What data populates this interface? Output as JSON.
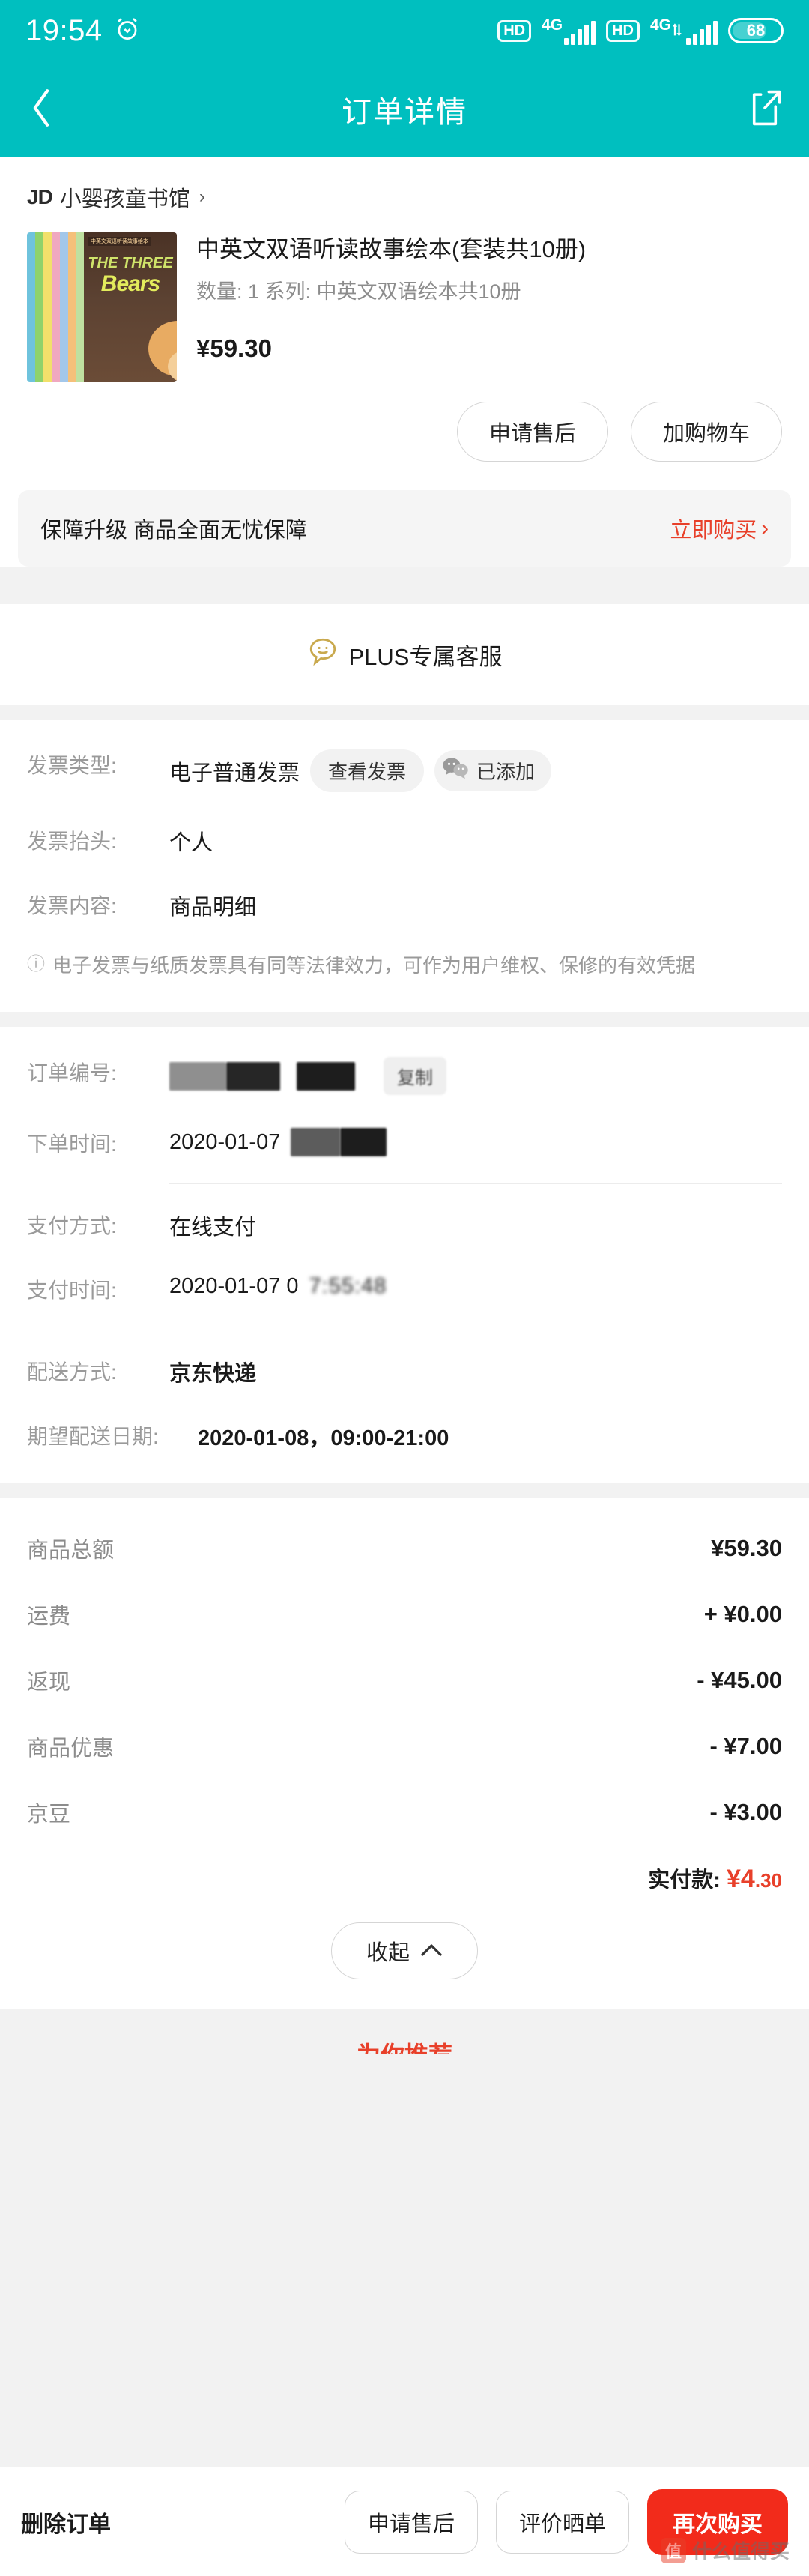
{
  "status_bar": {
    "time": "19:54",
    "alarm_icon": "alarm-clock-icon",
    "hd1": "HD",
    "net1": "4G",
    "hd2": "HD",
    "net2": "4G",
    "battery_level": "68"
  },
  "nav": {
    "back_icon": "chevron-left-icon",
    "title": "订单详情",
    "share_icon": "share-icon"
  },
  "shop": {
    "logo": "JD",
    "name": "小婴孩童书馆",
    "arrow": "›"
  },
  "product": {
    "title": "中英文双语听读故事绘本(套装共10册)",
    "meta": "数量: 1  系列: 中英文双语绘本共10册",
    "price": "¥59.30",
    "cover_title_small": "THE THREE",
    "cover_title_big": "Bears",
    "cover_tag": "中英文双语听读故事绘本"
  },
  "actions": {
    "after_sales": "申请售后",
    "add_cart": "加购物车"
  },
  "guarantee": {
    "text": "保障升级  商品全面无忧保障",
    "cta": "立即购买",
    "cta_arrow": "›"
  },
  "plus_service": {
    "icon": "smiley-chat-icon",
    "label": "PLUS专属客服"
  },
  "invoice": {
    "type_label": "发票类型:",
    "type_value": "电子普通发票",
    "view_chip": "查看发票",
    "wechat_icon": "wechat-icon",
    "wechat_status": "已添加",
    "title_label": "发票抬头:",
    "title_value": "个人",
    "content_label": "发票内容:",
    "content_value": "商品明细",
    "notice_icon": "info-icon",
    "notice_text": "电子发票与纸质发票具有同等法律效力，可作为用户维权、保修的有效凭据"
  },
  "order": {
    "number_label": "订单编号:",
    "number_value": "",
    "copy_chip": "复制",
    "created_label": "下单时间:",
    "created_value": "2020-01-07",
    "pay_method_label": "支付方式:",
    "pay_method_value": "在线支付",
    "pay_time_label": "支付时间:",
    "pay_time_value": "2020-01-07 0",
    "ship_method_label": "配送方式:",
    "ship_method_value": "京东快递",
    "ship_date_label": "期望配送日期:",
    "ship_date_value": "2020-01-08，09:00-21:00"
  },
  "summary": {
    "rows": [
      {
        "label": "商品总额",
        "value": "¥59.30"
      },
      {
        "label": "运费",
        "value": "+ ¥0.00"
      },
      {
        "label": "返现",
        "value": "- ¥45.00"
      },
      {
        "label": "商品优惠",
        "value": "- ¥7.00"
      },
      {
        "label": "京豆",
        "value": "- ¥3.00"
      }
    ],
    "paid_label": "实付款:",
    "paid_currency": "¥",
    "paid_int": "4",
    "paid_cent": ".30",
    "collapse_label": "收起",
    "collapse_icon": "chevron-up-icon"
  },
  "recommend": {
    "title_prefix": "为",
    "title": "为你推荐"
  },
  "bottom_bar": {
    "delete_order": "删除订单",
    "after_sales": "申请售后",
    "review": "评价晒单",
    "buy_again": "再次购买"
  },
  "watermark": {
    "badge": "值",
    "text": "什么值得买"
  },
  "colors": {
    "brand_teal": "#00bfbf",
    "accent_red": "#e8402a",
    "buy_red": "#f22b1b",
    "page_bg": "#f2f2f2"
  }
}
